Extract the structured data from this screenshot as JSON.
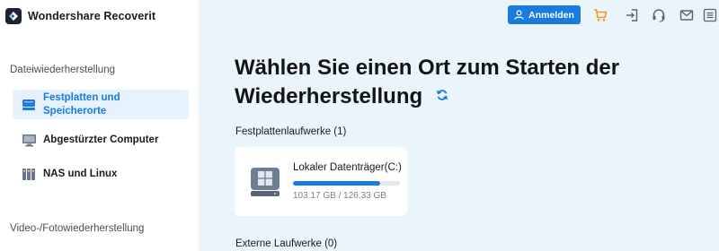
{
  "app": {
    "title": "Wondershare Recoverit"
  },
  "sidebar": {
    "section_recovery": "Dateiwiederherstellung",
    "items": [
      {
        "label": "Festplatten und Speicherorte",
        "active": true
      },
      {
        "label": "Abgestürzter Computer",
        "active": false
      },
      {
        "label": "NAS und Linux",
        "active": false
      }
    ],
    "section_media": "Video-/Fotowiederherstellung"
  },
  "toolbar": {
    "login_label": "Anmelden",
    "icons": [
      "cart-icon",
      "sign-in-icon",
      "headset-icon",
      "mail-icon",
      "menu-icon"
    ]
  },
  "main": {
    "title": "Wählen Sie einen Ort zum Starten der Wiederherstellung",
    "drives_header": "Festplattenlaufwerke (1)",
    "drives": [
      {
        "name": "Lokaler Datenträger(C:)",
        "usage": "103.17 GB / 126.33 GB",
        "used_fraction": 0.8167
      }
    ],
    "external_header": "Externe Laufwerke (0)"
  },
  "colors": {
    "accent": "#1a7ae0",
    "cart": "#f39c1f",
    "main_bg": "#e9f4fb",
    "sidebar_active_bg": "#e6f2fc"
  }
}
